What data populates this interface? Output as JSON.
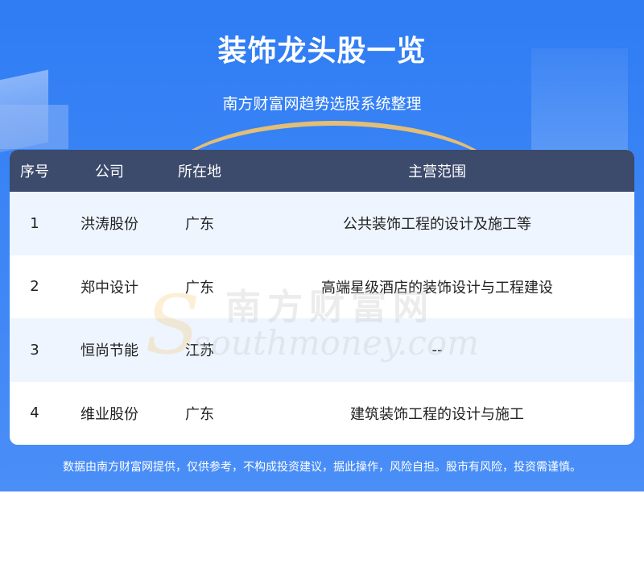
{
  "header": {
    "title": "装饰龙头股一览",
    "subtitle": "南方财富网趋势选股系统整理"
  },
  "table": {
    "columns": [
      "序号",
      "公司",
      "所在地",
      "主营范围"
    ],
    "rows": [
      {
        "index": "1",
        "company": "洪涛股份",
        "location": "广东",
        "business": "公共装饰工程的设计及施工等"
      },
      {
        "index": "2",
        "company": "郑中设计",
        "location": "广东",
        "business": "高端星级酒店的装饰设计与工程建设"
      },
      {
        "index": "3",
        "company": "恒尚节能",
        "location": "江苏",
        "business": "--"
      },
      {
        "index": "4",
        "company": "维业股份",
        "location": "广东",
        "business": "建筑装饰工程的设计与施工"
      }
    ]
  },
  "watermark": {
    "cn": "南方财富网",
    "en": "southmoney.com",
    "s": "S"
  },
  "footer": {
    "disclaimer": "数据由南方财富网提供，仅供参考，不构成投资建议，据此操作，风险自担。股市有风险，投资需谨慎。"
  },
  "colors": {
    "banner": "#2f7cf3",
    "table_header": "#3c4a6c",
    "row_alt": "#eef5ff"
  }
}
